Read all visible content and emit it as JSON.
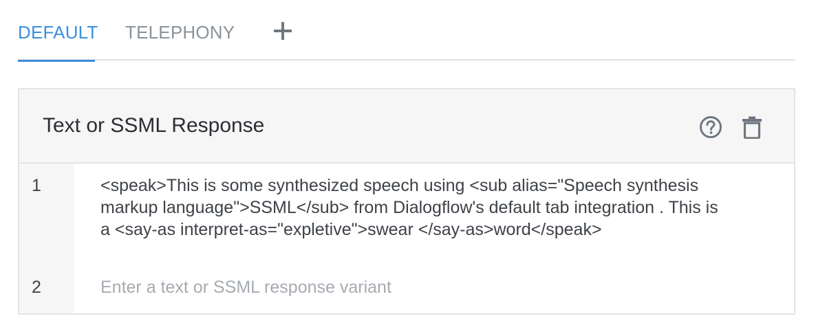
{
  "tabs": {
    "default_label": "DEFAULT",
    "telephony_label": "TELEPHONY",
    "add_icon": "plus-icon"
  },
  "card": {
    "title": "Text or SSML Response",
    "help_icon": "help-circle-icon",
    "delete_icon": "trash-icon",
    "rows": [
      {
        "number": "1",
        "text": "<speak>This is some synthesized speech using <sub alias=\"Speech synthesis markup language\">SSML</sub> from Dialogflow's default tab integration . This is a  <say-as interpret-as=\"expletive\">swear </say-as>word</speak>"
      },
      {
        "number": "2",
        "placeholder": "Enter a text or SSML response variant"
      }
    ]
  },
  "colors": {
    "accent": "#3c8fdb",
    "muted_tab": "#8a9299",
    "text": "#3e4247",
    "placeholder": "#a6abb1",
    "header_bg": "#f6f6f7"
  }
}
